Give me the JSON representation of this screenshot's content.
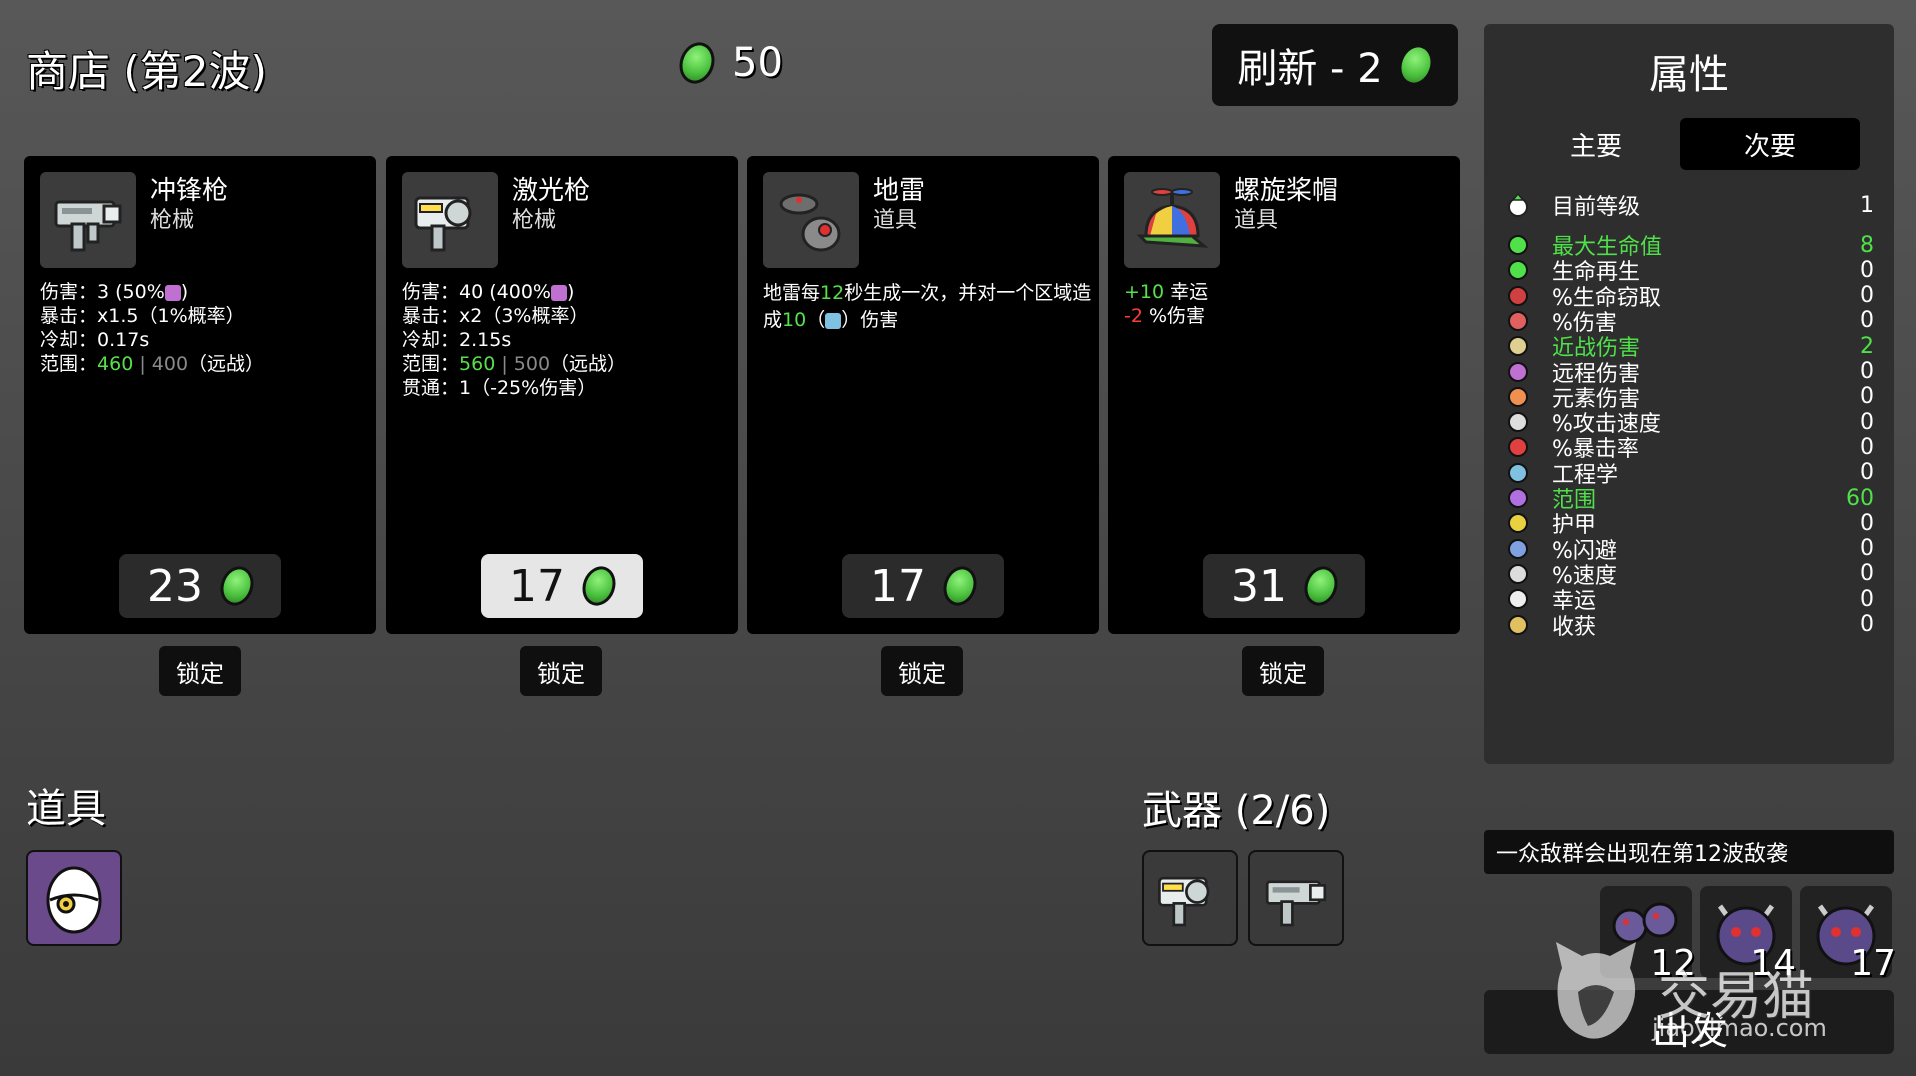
{
  "header": {
    "title": "商店 (第2波)",
    "gold": "50",
    "refresh_label": "刷新 - 2"
  },
  "cards": [
    {
      "name": "冲锋枪",
      "category": "枪械",
      "icon": "smg-icon",
      "lines": [
        {
          "label": "伤害：",
          "parts": [
            {
              "t": "3 (50%",
              "c": ""
            },
            {
              "t": "",
              "icon": "ranged-icon"
            },
            {
              "t": ")",
              "c": ""
            }
          ]
        },
        {
          "label": "暴击：",
          "parts": [
            {
              "t": "x1.5（1%概率）",
              "c": ""
            }
          ]
        },
        {
          "label": "冷却：",
          "parts": [
            {
              "t": "0.17s",
              "c": ""
            }
          ]
        },
        {
          "label": "范围：",
          "parts": [
            {
              "t": "460",
              "c": "g"
            },
            {
              "t": " | ",
              "c": "gr"
            },
            {
              "t": "400",
              "c": "gr"
            },
            {
              "t": "（远战）",
              "c": ""
            }
          ]
        }
      ],
      "price": "23",
      "price_highlight": false,
      "lock_label": "锁定"
    },
    {
      "name": "激光枪",
      "category": "枪械",
      "icon": "laser-gun-icon",
      "lines": [
        {
          "label": "伤害：",
          "parts": [
            {
              "t": "40 (400%",
              "c": ""
            },
            {
              "t": "",
              "icon": "ranged-icon"
            },
            {
              "t": ")",
              "c": ""
            }
          ]
        },
        {
          "label": "暴击：",
          "parts": [
            {
              "t": "x2（3%概率）",
              "c": ""
            }
          ]
        },
        {
          "label": "冷却：",
          "parts": [
            {
              "t": "2.15s",
              "c": ""
            }
          ]
        },
        {
          "label": "范围：",
          "parts": [
            {
              "t": "560",
              "c": "g"
            },
            {
              "t": " | ",
              "c": "gr"
            },
            {
              "t": "500",
              "c": "gr"
            },
            {
              "t": "（远战）",
              "c": ""
            }
          ]
        },
        {
          "label": "贯通：",
          "parts": [
            {
              "t": "1（-25%伤害）",
              "c": ""
            }
          ]
        }
      ],
      "price": "17",
      "price_highlight": true,
      "lock_label": "锁定"
    },
    {
      "name": "地雷",
      "category": "道具",
      "icon": "landmine-icon",
      "desc_parts": [
        {
          "t": "地雷每",
          "c": ""
        },
        {
          "t": "12",
          "c": "g"
        },
        {
          "t": "秒生成一次，并对一个区域造成",
          "c": ""
        },
        {
          "t": "10",
          "c": "g"
        },
        {
          "t": "（",
          "c": ""
        },
        {
          "t": "",
          "icon": "engineering-icon"
        },
        {
          "t": "）伤害",
          "c": ""
        }
      ],
      "price": "17",
      "price_highlight": false,
      "lock_label": "锁定"
    },
    {
      "name": "螺旋桨帽",
      "category": "道具",
      "icon": "propeller-hat-icon",
      "lines": [
        {
          "label": "",
          "parts": [
            {
              "t": "+10",
              "c": "g"
            },
            {
              "t": " 幸运",
              "c": ""
            }
          ]
        },
        {
          "label": "",
          "parts": [
            {
              "t": "-2",
              "c": "r"
            },
            {
              "t": " %伤害",
              "c": ""
            }
          ]
        }
      ],
      "price": "31",
      "price_highlight": false,
      "lock_label": "锁定"
    }
  ],
  "items_section": {
    "title": "道具",
    "items": [
      {
        "icon": "egg-icon"
      }
    ]
  },
  "weapons_section": {
    "title": "武器 (2/6)",
    "items": [
      {
        "icon": "laser-gun-icon"
      },
      {
        "icon": "smg-icon"
      }
    ]
  },
  "stats": {
    "title": "属性",
    "tabs": [
      "主要",
      "次要"
    ],
    "active_tab": 1,
    "level": {
      "label": "目前等级",
      "value": "1",
      "icon": "level-icon"
    },
    "rows": [
      {
        "label": "最大生命值",
        "value": "8",
        "highlight": true,
        "icon": "heart-icon",
        "color": "#4fe04a"
      },
      {
        "label": "生命再生",
        "value": "0",
        "highlight": false,
        "icon": "regen-icon",
        "color": "#4fe04a"
      },
      {
        "label": "%生命窃取",
        "value": "0",
        "highlight": false,
        "icon": "lifesteal-icon",
        "color": "#d04040"
      },
      {
        "label": "%伤害",
        "value": "0",
        "highlight": false,
        "icon": "damage-icon",
        "color": "#e06060"
      },
      {
        "label": "近战伤害",
        "value": "2",
        "highlight": true,
        "icon": "melee-icon",
        "color": "#e0d090"
      },
      {
        "label": "远程伤害",
        "value": "0",
        "highlight": false,
        "icon": "ranged-icon",
        "color": "#c070d0"
      },
      {
        "label": "元素伤害",
        "value": "0",
        "highlight": false,
        "icon": "elemental-icon",
        "color": "#f09050"
      },
      {
        "label": "%攻击速度",
        "value": "0",
        "highlight": false,
        "icon": "attack-speed-icon",
        "color": "#dddddd"
      },
      {
        "label": "%暴击率",
        "value": "0",
        "highlight": false,
        "icon": "crit-icon",
        "color": "#e04040"
      },
      {
        "label": "工程学",
        "value": "0",
        "highlight": false,
        "icon": "engineering-icon",
        "color": "#80c0e0"
      },
      {
        "label": "范围",
        "value": "60",
        "highlight": true,
        "icon": "range-icon",
        "color": "#b070e0"
      },
      {
        "label": "护甲",
        "value": "0",
        "highlight": false,
        "icon": "armor-icon",
        "color": "#e8d040"
      },
      {
        "label": "%闪避",
        "value": "0",
        "highlight": false,
        "icon": "dodge-icon",
        "color": "#80a0e0"
      },
      {
        "label": "%速度",
        "value": "0",
        "highlight": false,
        "icon": "speed-icon",
        "color": "#dddddd"
      },
      {
        "label": "幸运",
        "value": "0",
        "highlight": false,
        "icon": "luck-icon",
        "color": "#eeeeee"
      },
      {
        "label": "收获",
        "value": "0",
        "highlight": false,
        "icon": "harvest-icon",
        "color": "#e0c060"
      }
    ]
  },
  "wave_notice": "一众敌群会出现在第12波敌袭",
  "enemies": [
    {
      "wave": "12",
      "icon": "enemy-horde-icon"
    },
    {
      "wave": "14",
      "icon": "elite-enemy-icon"
    },
    {
      "wave": "17",
      "icon": "elite-enemy-icon"
    }
  ],
  "go_label": "出发",
  "watermark": {
    "main": "交易猫",
    "sub": "jiaoyimao.com"
  },
  "colors": {
    "accent_green": "#56e04a",
    "stat_green": "#4fe04a",
    "negative_red": "#ff3b3b",
    "muted": "#8a8a8a"
  }
}
